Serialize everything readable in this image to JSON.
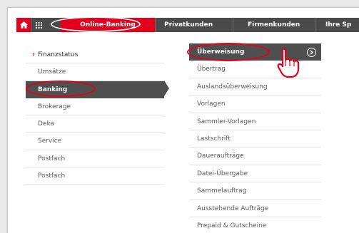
{
  "nav": {
    "home_icon": "home-icon",
    "grid_icon": "grid-icon",
    "items": [
      {
        "label": "Online-Banking"
      },
      {
        "label": "Privatkunden"
      },
      {
        "label": "Firmenkunden"
      },
      {
        "label": "Ihre Sp"
      }
    ]
  },
  "left_menu": {
    "items": [
      {
        "label": "Finanzstatus"
      },
      {
        "label": "Umsätze"
      },
      {
        "label": "Banking"
      },
      {
        "label": "Brokerage"
      },
      {
        "label": "Deka"
      },
      {
        "label": "Service"
      },
      {
        "label": "Postfach"
      },
      {
        "label": "Postfach"
      }
    ]
  },
  "right_menu": {
    "items": [
      {
        "label": "Überweisung"
      },
      {
        "label": "Übertrag"
      },
      {
        "label": "Auslandsüberweisung"
      },
      {
        "label": "Vorlagen"
      },
      {
        "label": "Sammler-Vorlagen"
      },
      {
        "label": "Lastschrift"
      },
      {
        "label": "Daueraufträge"
      },
      {
        "label": "Datei-Übergabe"
      },
      {
        "label": "Sammelauftrag"
      },
      {
        "label": "Ausstehende Aufträge"
      },
      {
        "label": "Prepaid & Gutscheine"
      }
    ]
  },
  "colors": {
    "brand_red": "#e4001a",
    "nav_dark": "#4a4a4a",
    "active_row": "#4f4f4f"
  }
}
